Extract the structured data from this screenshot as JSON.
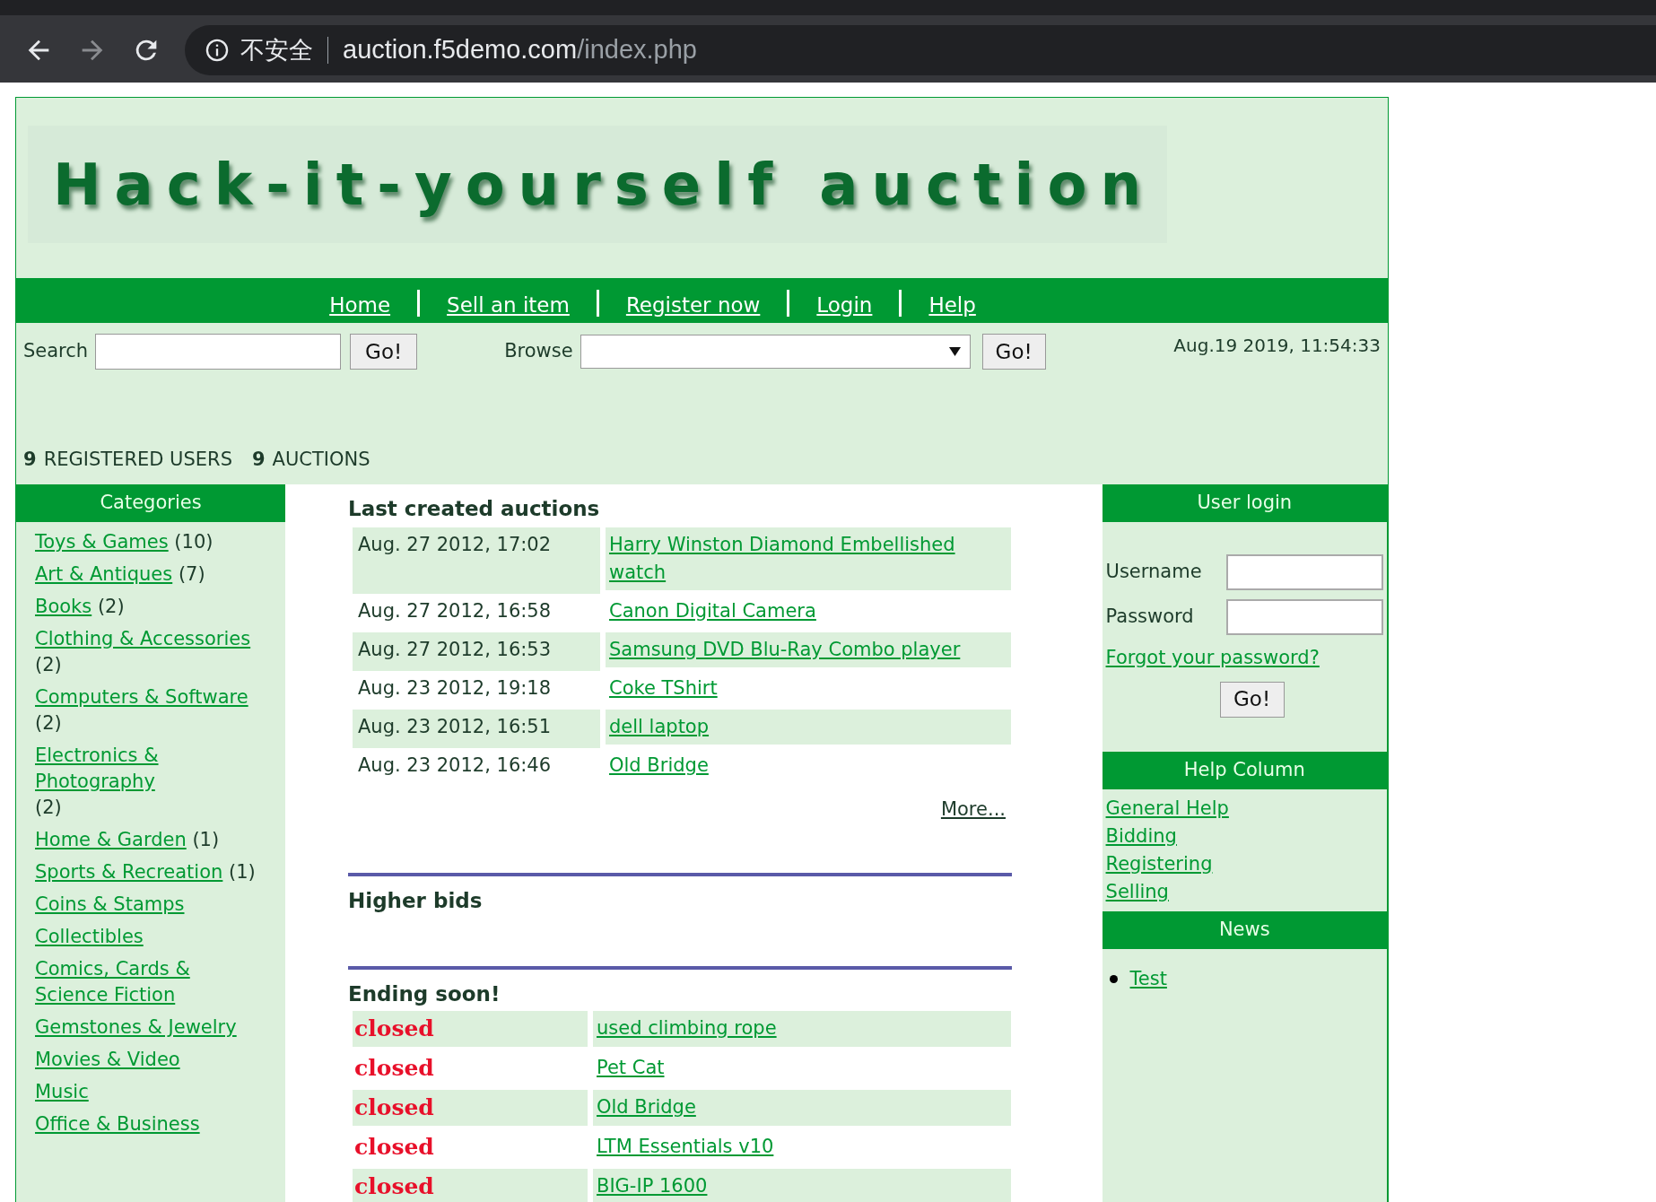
{
  "browser": {
    "security_label": "不安全",
    "url_host": "auction.f5demo.com",
    "url_path": "/index.php"
  },
  "header": {
    "logo_text": "Hack-it-yourself auction"
  },
  "nav": [
    {
      "label": "Home"
    },
    {
      "label": "Sell an item"
    },
    {
      "label": "Register now"
    },
    {
      "label": "Login"
    },
    {
      "label": "Help"
    }
  ],
  "search": {
    "label": "Search",
    "button": "Go!"
  },
  "browse": {
    "label": "Browse",
    "button": "Go!"
  },
  "datetime": "Aug.19 2019, 11:54:33",
  "stats": [
    {
      "count": "9",
      "label": "REGISTERED USERS"
    },
    {
      "count": "9",
      "label": "AUCTIONS"
    }
  ],
  "categories": {
    "title": "Categories",
    "items": [
      {
        "name": "Toys & Games",
        "count": "(10)"
      },
      {
        "name": "Art & Antiques",
        "count": "(7)"
      },
      {
        "name": "Books",
        "count": "(2)"
      },
      {
        "name": "Clothing & Accessories",
        "count": "(2)"
      },
      {
        "name": "Computers & Software",
        "count": "(2)"
      },
      {
        "name": "Electronics & Photography",
        "count": "(2)"
      },
      {
        "name": "Home & Garden",
        "count": "(1)"
      },
      {
        "name": "Sports & Recreation",
        "count": "(1)"
      },
      {
        "name": "Coins & Stamps"
      },
      {
        "name": "Collectibles"
      },
      {
        "name": "Comics, Cards & Science Fiction"
      },
      {
        "name": "Gemstones & Jewelry"
      },
      {
        "name": "Movies & Video"
      },
      {
        "name": "Music"
      },
      {
        "name": "Office & Business"
      }
    ]
  },
  "last_created": {
    "title": "Last created auctions",
    "rows": [
      {
        "date": "Aug. 27 2012, 17:02",
        "item": "Harry Winston Diamond Embellished watch"
      },
      {
        "date": "Aug. 27 2012, 16:58",
        "item": "Canon Digital Camera"
      },
      {
        "date": "Aug. 27 2012, 16:53",
        "item": "Samsung DVD Blu-Ray Combo player"
      },
      {
        "date": "Aug. 23 2012, 19:18",
        "item": "Coke TShirt"
      },
      {
        "date": "Aug. 23 2012, 16:51",
        "item": "dell laptop"
      },
      {
        "date": "Aug. 23 2012, 16:46",
        "item": "Old Bridge"
      }
    ],
    "more_link": "More..."
  },
  "higher_bids": {
    "title": "Higher bids"
  },
  "ending_soon": {
    "title": "Ending soon!",
    "rows": [
      {
        "status": "closed",
        "item": "used climbing rope"
      },
      {
        "status": "closed",
        "item": "Pet Cat"
      },
      {
        "status": "closed",
        "item": "Old Bridge"
      },
      {
        "status": "closed",
        "item": "LTM Essentials v10"
      },
      {
        "status": "closed",
        "item": "BIG-IP 1600"
      }
    ]
  },
  "user_login": {
    "title": "User login",
    "username_label": "Username",
    "password_label": "Password",
    "forgot_link": "Forgot your password?",
    "button": "Go!"
  },
  "help_column": {
    "title": "Help Column",
    "links": [
      "General Help",
      "Bidding",
      "Registering",
      "Selling"
    ]
  },
  "news": {
    "title": "News",
    "items": [
      "Test"
    ]
  }
}
